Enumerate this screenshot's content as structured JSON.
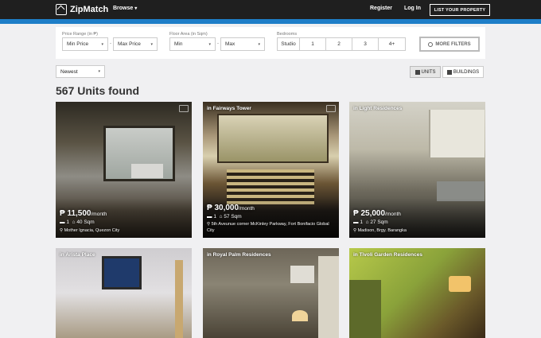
{
  "nav": {
    "logo": "ZipMatch",
    "browse": "Browse",
    "register": "Register",
    "login": "Log In",
    "list_property": "LIST YOUR PROPERTY"
  },
  "filters": {
    "price_label": "Price Range (in ₱)",
    "min_price": "Min Price",
    "max_price": "Max Price",
    "area_label": "Floor Area (in Sqm)",
    "min_area": "Min",
    "max_area": "Max",
    "bedrooms_label": "Bedrooms",
    "bedrooms": [
      "Studio",
      "1",
      "2",
      "3",
      "4+"
    ],
    "more_filters": "MORE FILTERS"
  },
  "sort": {
    "selected": "Newest"
  },
  "view_toggle": {
    "units": "UNITS",
    "buildings": "BUILDINGS"
  },
  "results_count": "567 Units found",
  "cards": [
    {
      "label": "",
      "price": "₱ 11,500",
      "per": "/month",
      "beds": "1",
      "area": "40 Sqm",
      "address": "Mother Ignacia, Quezon City"
    },
    {
      "label": "in Fairways Tower",
      "price": "₱ 30,000",
      "per": "/month",
      "beds": "1",
      "area": "57 Sqm",
      "address": "5th Aveunue corner McKinley Parkway, Fort Bonifacio Global City"
    },
    {
      "label": "in Light Residences",
      "price": "₱ 25,000",
      "per": "/month",
      "beds": "1",
      "area": "27 Sqm",
      "address": "Madison, Brgy. Barangka"
    },
    {
      "label": "in Arista Place"
    },
    {
      "label": "in Royal Palm Residences"
    },
    {
      "label": "in Tivoli Garden Residences"
    }
  ]
}
